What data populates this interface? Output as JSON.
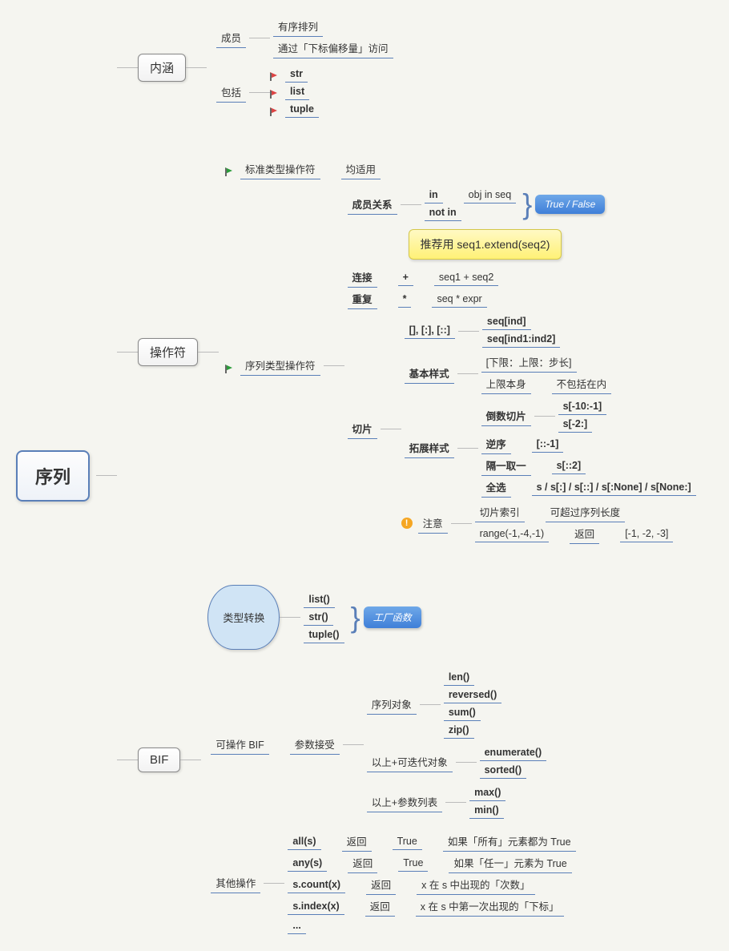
{
  "root": "序列",
  "b1": {
    "title": "内涵",
    "members_label": "成员",
    "members": [
      "有序排列",
      "通过「下标偏移量」访问"
    ],
    "includes_label": "包括",
    "includes": [
      "str",
      "list",
      "tuple"
    ]
  },
  "b2": {
    "title": "操作符",
    "std_label": "标准类型操作符",
    "std_note": "均适用",
    "seq_label": "序列类型操作符",
    "member_rel": "成员关系",
    "in": "in",
    "in_expr": "obj in seq",
    "notin": "not in",
    "tf_callout": "True / False",
    "recommend": "推荐用 seq1.extend(seq2)",
    "concat": "连接",
    "concat_op": "+",
    "concat_expr": "seq1 + seq2",
    "repeat": "重复",
    "repeat_op": "*",
    "repeat_expr": "seq * expr",
    "slice": "切片",
    "slice_syntax": "[], [:], [::]",
    "slice_s1": "seq[ind]",
    "slice_s2": "seq[ind1:ind2]",
    "basic": "基本样式",
    "basic_note": "[下限：上限：步长]",
    "upper_self": "上限本身",
    "upper_note": "不包括在内",
    "ext": "拓展样式",
    "neg_label": "倒数切片",
    "neg1": "s[-10:-1]",
    "neg2": "s[-2:]",
    "rev_label": "逆序",
    "rev_expr": "[::-1]",
    "alt_label": "隔一取一",
    "alt_expr": "s[::2]",
    "all_label": "全选",
    "all_expr": "s / s[:] / s[::] / s[:None] / s[None:]",
    "warn": "注意",
    "warn1_a": "切片索引",
    "warn1_b": "可超过序列长度",
    "warn2_a": "range(-1,-4,-1)",
    "warn2_b": "返回",
    "warn2_c": "[-1, -2, -3]"
  },
  "b3": {
    "title": "BIF",
    "typeconv": "类型转换",
    "typeconv_items": [
      "list()",
      "str()",
      "tuple()"
    ],
    "factory": "工厂函数",
    "op_bif": "可操作 BIF",
    "param_accept": "参数接受",
    "seq_obj": "序列对象",
    "seq_obj_items": [
      "len()",
      "reversed()",
      "sum()",
      "zip()"
    ],
    "iter": "以上+可迭代对象",
    "iter_items": [
      "enumerate()",
      "sorted()"
    ],
    "paramlist": "以上+参数列表",
    "paramlist_items": [
      "max()",
      "min()"
    ],
    "other": "其他操作",
    "other_rows": [
      {
        "name": "all(s)",
        "ret": "返回",
        "val": "True",
        "desc": "如果「所有」元素都为 True"
      },
      {
        "name": "any(s)",
        "ret": "返回",
        "val": "True",
        "desc": "如果「任一」元素为 True"
      },
      {
        "name": "s.count(x)",
        "ret": "返回",
        "val": "",
        "desc": "x 在 s 中出现的「次数」"
      },
      {
        "name": "s.index(x)",
        "ret": "返回",
        "val": "",
        "desc": "x 在 s 中第一次出现的「下标」"
      },
      {
        "name": "...",
        "ret": "",
        "val": "",
        "desc": ""
      }
    ]
  }
}
